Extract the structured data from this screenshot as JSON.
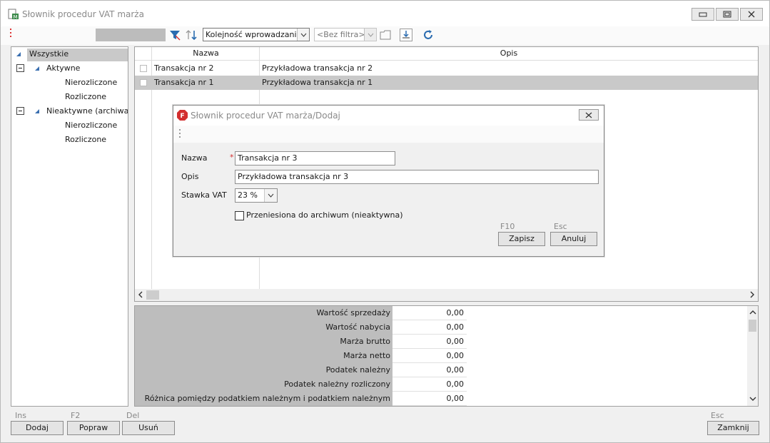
{
  "window": {
    "title": "Słownik procedur VAT marża"
  },
  "toolbar": {
    "sort_value": "Kolejność wprowadzania",
    "filter_placeholder": "<Bez filtra>"
  },
  "tree": {
    "root": "Wszystkie",
    "active": "Aktywne",
    "active_children": [
      "Nierozliczone",
      "Rozliczone"
    ],
    "inactive": "Nieaktywne (archiwalne)",
    "inactive_children": [
      "Nierozliczone",
      "Rozliczone"
    ]
  },
  "grid": {
    "columns": [
      "Nazwa",
      "Opis"
    ],
    "rows": [
      {
        "name": "Transakcja nr 2",
        "desc": "Przykładowa transakcja nr 2"
      },
      {
        "name": "Transakcja nr 1",
        "desc": "Przykładowa transakcja nr 1"
      }
    ]
  },
  "summary": [
    {
      "label": "Wartość sprzedaży",
      "value": "0,00"
    },
    {
      "label": "Wartość nabycia",
      "value": "0,00"
    },
    {
      "label": "Marża brutto",
      "value": "0,00"
    },
    {
      "label": "Marża netto",
      "value": "0,00"
    },
    {
      "label": "Podatek należny",
      "value": "0,00"
    },
    {
      "label": "Podatek należny rozliczony",
      "value": "0,00"
    },
    {
      "label": "Różnica pomiędzy podatkiem należnym i podatkiem należnym rozliczonym",
      "value": "0,00"
    }
  ],
  "bottom": {
    "add": {
      "key": "Ins",
      "label": "Dodaj"
    },
    "edit": {
      "key": "F2",
      "label": "Popraw"
    },
    "delete": {
      "key": "Del",
      "label": "Usuń"
    },
    "close": {
      "key": "Esc",
      "label": "Zamknij"
    }
  },
  "dialog": {
    "title": "Słownik procedur VAT marża/Dodaj",
    "name_label": "Nazwa",
    "name_value": "Transakcja nr 3",
    "required_mark": "*",
    "desc_label": "Opis",
    "desc_value": "Przykładowa transakcja nr 3",
    "vat_label": "Stawka VAT",
    "vat_value": "23 %",
    "archive_label": "Przeniesiona do archiwum (nieaktywna)",
    "save_key": "F10",
    "save_label": "Zapisz",
    "cancel_key": "Esc",
    "cancel_label": "Anuluj"
  },
  "colors": {
    "selection": "#c9c9c9",
    "summary_label_bg": "#bdbdbd",
    "accent_blue": "#2b6cb0",
    "required_red": "#d32f2f"
  }
}
